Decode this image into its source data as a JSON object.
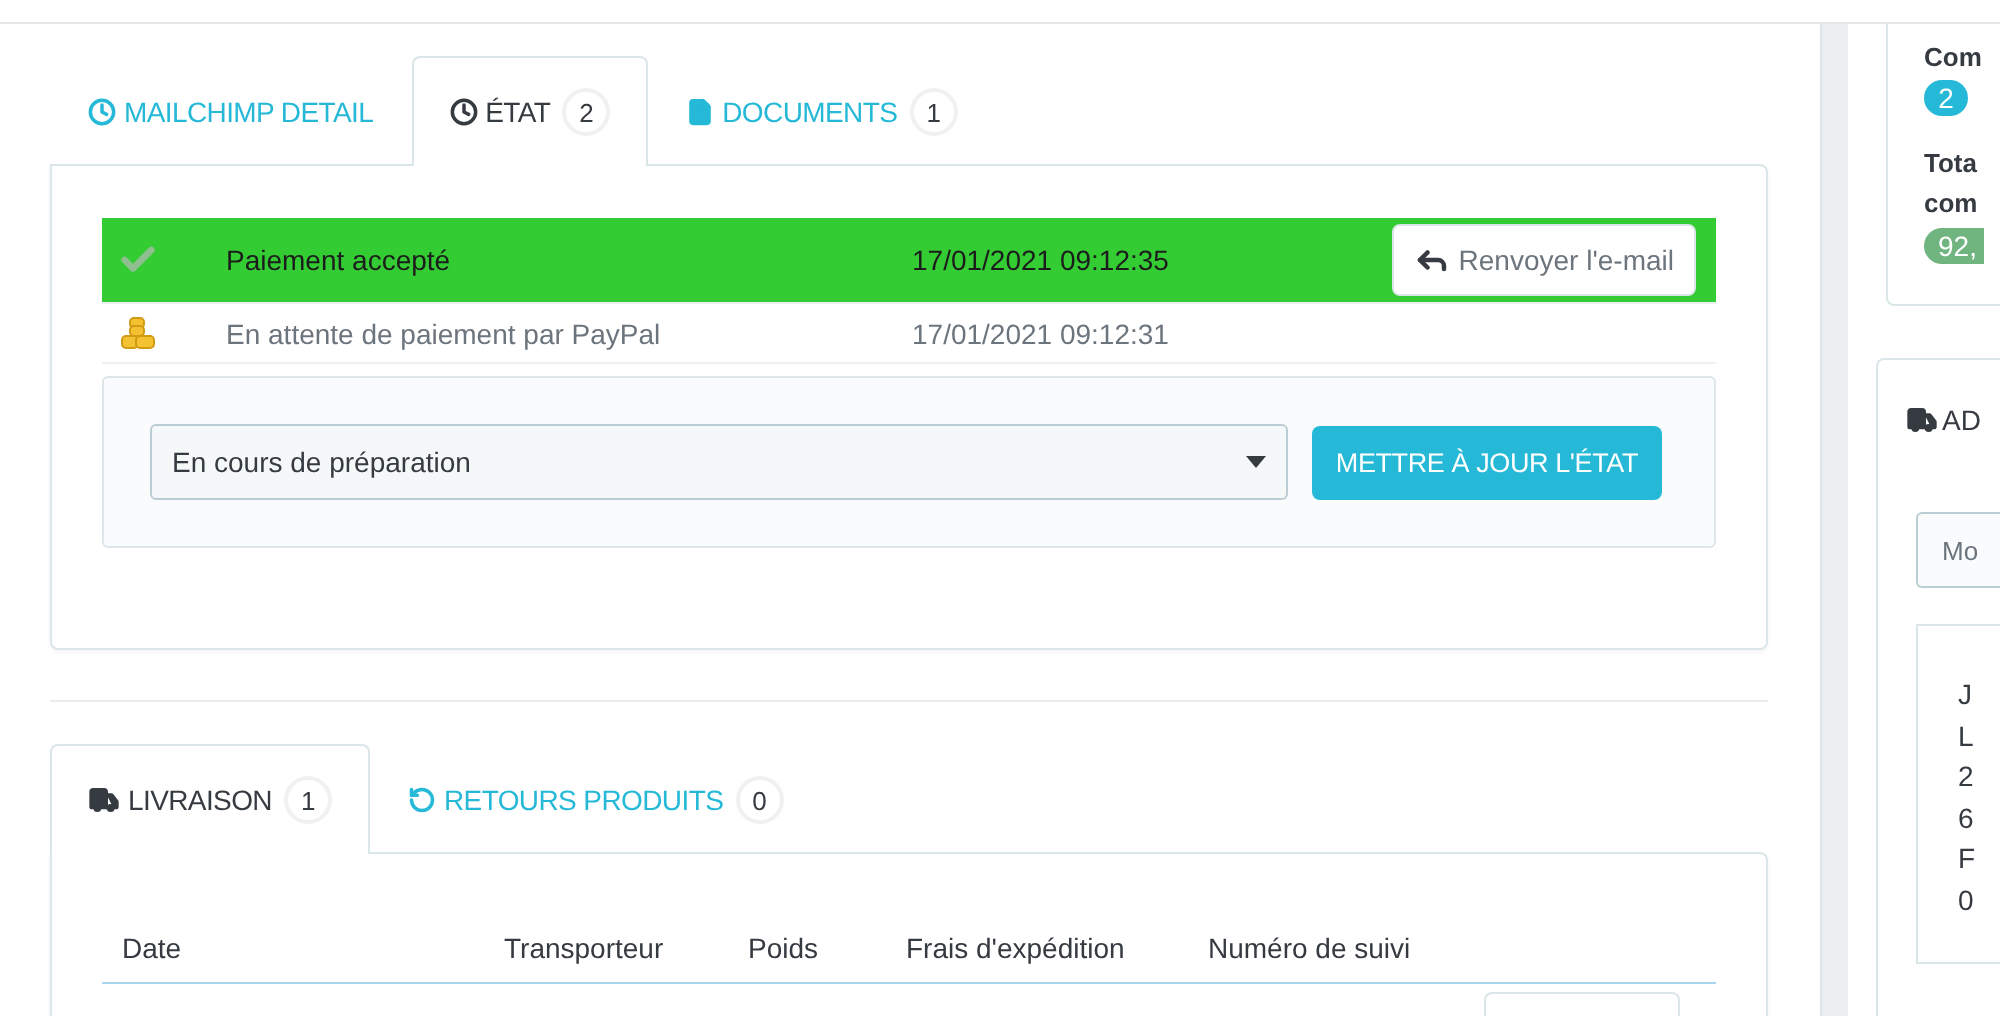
{
  "tabs": [
    {
      "label": "MAILCHIMP DETAIL",
      "selected": false
    },
    {
      "label": "ÉTAT",
      "count": "2",
      "selected": true
    },
    {
      "label": "DOCUMENTS",
      "count": "1",
      "selected": false
    }
  ],
  "history": [
    {
      "status": "Paiement accepté",
      "date": "17/01/2021 09:12:35",
      "color": "#33cc33",
      "action": "Renvoyer l'e-mail"
    },
    {
      "status": "En attente de paiement par PayPal",
      "date": "17/01/2021 09:12:31"
    }
  ],
  "status_form": {
    "value": "En cours de préparation",
    "button": "METTRE À JOUR L'ÉTAT"
  },
  "shipping_tabs": [
    {
      "label": "LIVRAISON",
      "count": "1",
      "selected": true
    },
    {
      "label": "RETOURS PRODUITS",
      "count": "0",
      "selected": false
    }
  ],
  "shipping_table": {
    "columns": [
      "Date",
      "Transporteur",
      "Poids",
      "Frais d'expédition",
      "Numéro de suivi"
    ]
  },
  "sidebar": {
    "customer_card": {
      "orders_label": "Com",
      "orders_count": "2",
      "total_label": [
        "Tota",
        "com"
      ],
      "total": "92,"
    },
    "address_card": {
      "title": "AD",
      "button": "Mo",
      "lines": [
        "J",
        "L",
        "2",
        "6",
        "F",
        "0"
      ]
    }
  }
}
